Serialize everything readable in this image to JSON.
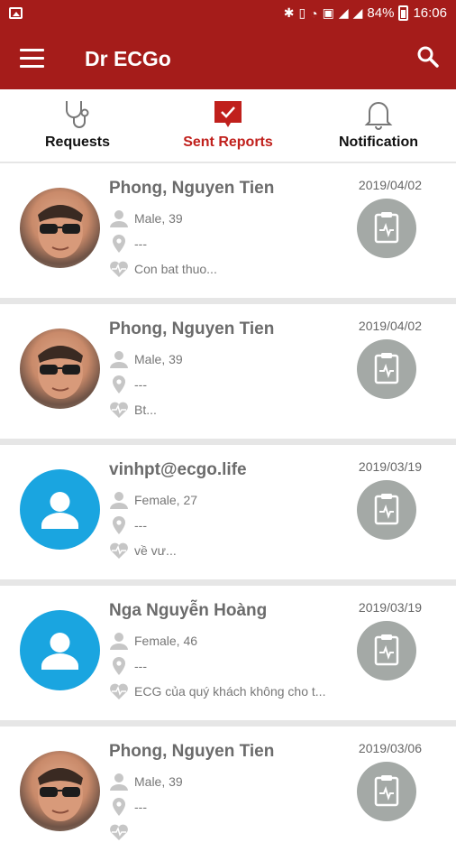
{
  "status_bar": {
    "battery": "84%",
    "time": "16:06"
  },
  "app_bar": {
    "title": "Dr ECGo"
  },
  "tabs": [
    {
      "label": "Requests",
      "icon": "stethoscope-icon",
      "active": false
    },
    {
      "label": "Sent Reports",
      "icon": "report-check-icon",
      "active": true
    },
    {
      "label": "Notification",
      "icon": "bell-icon",
      "active": false
    }
  ],
  "colors": {
    "primary": "#a51c1a",
    "accent": "#c0201c",
    "avatar_placeholder": "#1aa5e0",
    "report_button": "#a4a9a6"
  },
  "reports": [
    {
      "name": "Phong, Nguyen Tien",
      "gender_age": "Male, 39",
      "location": "---",
      "diagnosis": "Con bat thuo...",
      "date": "2019/04/02",
      "avatar": "photo"
    },
    {
      "name": "Phong, Nguyen Tien",
      "gender_age": "Male, 39",
      "location": "---",
      "diagnosis": "Bt...",
      "date": "2019/04/02",
      "avatar": "photo"
    },
    {
      "name": "vinhpt@ecgo.life",
      "gender_age": "Female, 27",
      "location": "---",
      "diagnosis": "về vư...",
      "date": "2019/03/19",
      "avatar": "placeholder"
    },
    {
      "name": "Nga Nguyễn Hoàng",
      "gender_age": "Female, 46",
      "location": "---",
      "diagnosis": "ECG của quý khách không cho t...",
      "date": "2019/03/19",
      "avatar": "placeholder"
    },
    {
      "name": "Phong, Nguyen Tien",
      "gender_age": "Male, 39",
      "location": "---",
      "diagnosis": "",
      "date": "2019/03/06",
      "avatar": "photo"
    }
  ]
}
